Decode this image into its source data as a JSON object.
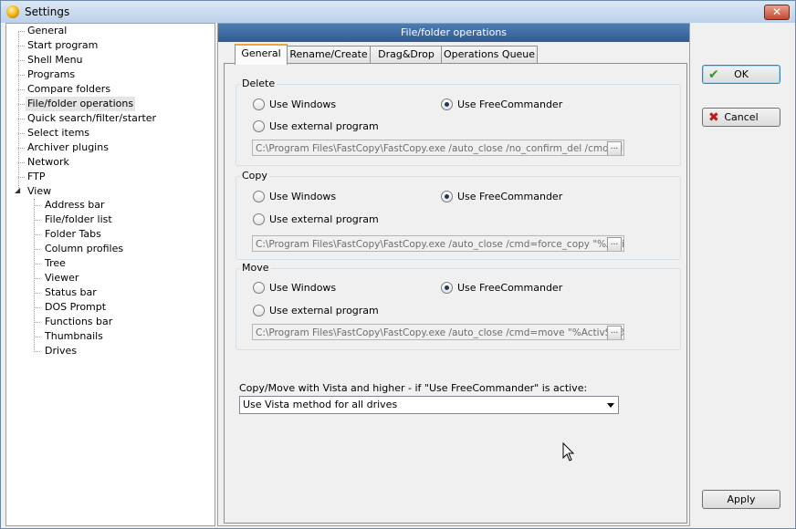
{
  "window": {
    "title": "Settings",
    "close_label": "✕"
  },
  "tree": {
    "items": [
      {
        "label": "General"
      },
      {
        "label": "Start program"
      },
      {
        "label": "Shell Menu"
      },
      {
        "label": "Programs"
      },
      {
        "label": "Compare folders"
      },
      {
        "label": "File/folder operations",
        "selected": true
      },
      {
        "label": "Quick search/filter/starter"
      },
      {
        "label": "Select items"
      },
      {
        "label": "Archiver plugins"
      },
      {
        "label": "Network"
      },
      {
        "label": "FTP"
      },
      {
        "label": "View",
        "expanded": true
      }
    ],
    "view_children": [
      {
        "label": "Address bar"
      },
      {
        "label": "File/folder list"
      },
      {
        "label": "Folder Tabs"
      },
      {
        "label": "Column profiles"
      },
      {
        "label": "Tree"
      },
      {
        "label": "Viewer"
      },
      {
        "label": "Status bar"
      },
      {
        "label": "DOS Prompt"
      },
      {
        "label": "Functions bar"
      },
      {
        "label": "Thumbnails"
      },
      {
        "label": "Drives"
      }
    ]
  },
  "panel": {
    "header": "File/folder operations",
    "tabs": [
      {
        "label": "General",
        "active": true
      },
      {
        "label": "Rename/Create"
      },
      {
        "label": "Drag&Drop"
      },
      {
        "label": "Operations Queue"
      }
    ],
    "groups": {
      "delete": {
        "label": "Delete",
        "use_windows": "Use Windows",
        "use_freecommander": "Use FreeCommander",
        "use_external": "Use external program",
        "path": "C:\\Program Files\\FastCopy\\FastCopy.exe /auto_close /no_confirm_del /cmd=delete",
        "selected": "use_freecommander"
      },
      "copy": {
        "label": "Copy",
        "use_windows": "Use Windows",
        "use_freecommander": "Use FreeCommander",
        "use_external": "Use external program",
        "path": "C:\\Program Files\\FastCopy\\FastCopy.exe /auto_close /cmd=force_copy \"%ActivSel%\"",
        "selected": "use_freecommander"
      },
      "move": {
        "label": "Move",
        "use_windows": "Use Windows",
        "use_freecommander": "Use FreeCommander",
        "use_external": "Use external program",
        "path": "C:\\Program Files\\FastCopy\\FastCopy.exe /auto_close /cmd=move \"%ActivSel%\"",
        "selected": "use_freecommander"
      }
    },
    "browse_label": "...",
    "vista_label": "Copy/Move with Vista and higher - if \"Use FreeCommander\" is active:",
    "vista_option": "Use Vista method for all drives"
  },
  "buttons": {
    "ok": "OK",
    "cancel": "Cancel",
    "apply": "Apply"
  },
  "icons": {
    "ok_icon": "checkmark-icon",
    "cancel_icon": "x-icon",
    "app_icon": "freecommander-icon"
  },
  "colors": {
    "header_blue": "#2f5b91",
    "ok_green": "#2a9a2a",
    "cancel_red": "#c01818",
    "tab_accent": "#f3a33a"
  }
}
